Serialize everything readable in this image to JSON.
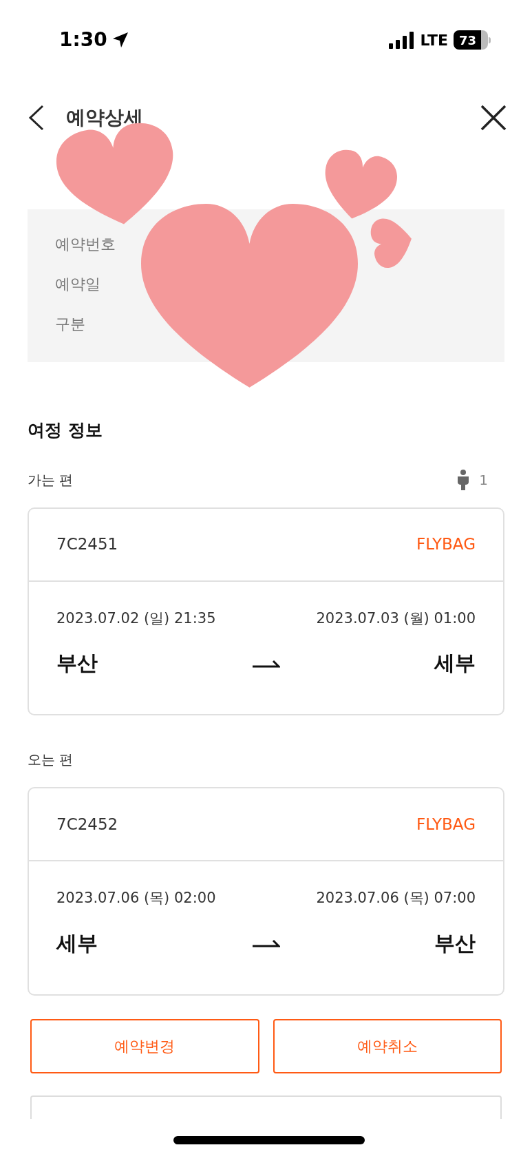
{
  "status_bar": {
    "time": "1:30",
    "network": "LTE",
    "battery": "73"
  },
  "header": {
    "title": "예약상세"
  },
  "summary": {
    "labels": [
      "예약번호",
      "예약일",
      "구분"
    ]
  },
  "itinerary": {
    "title": "여정 정보",
    "legs": [
      {
        "label": "가는 편",
        "passengers": "1",
        "flight": "7C2451",
        "fare": "FLYBAG",
        "depart_time": "2023.07.02 (일) 21:35",
        "arrive_time": "2023.07.03 (월) 01:00",
        "from": "부산",
        "to": "세부"
      },
      {
        "label": "오는 편",
        "flight": "7C2452",
        "fare": "FLYBAG",
        "depart_time": "2023.07.06 (목) 02:00",
        "arrive_time": "2023.07.06 (목) 07:00",
        "from": "세부",
        "to": "부산"
      }
    ]
  },
  "actions": [
    "예약변경",
    "예약취소"
  ],
  "stickers": [
    {
      "kind": "heart"
    },
    {
      "kind": "heart"
    },
    {
      "kind": "heart"
    },
    {
      "kind": "heart"
    }
  ]
}
